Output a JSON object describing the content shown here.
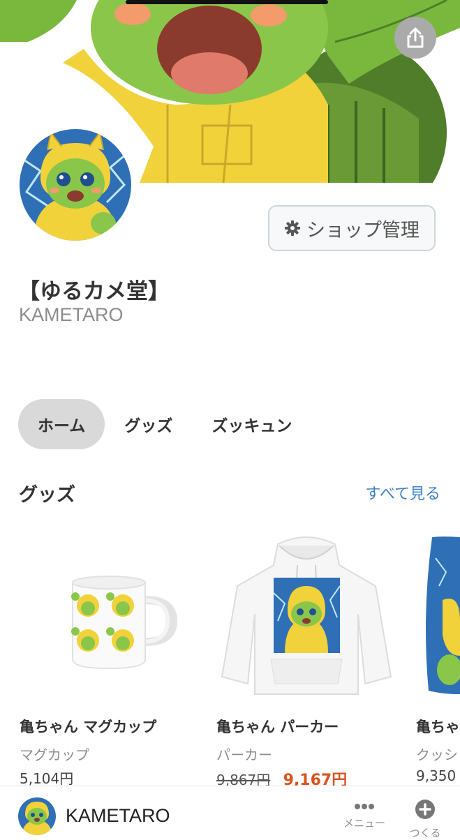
{
  "header": {
    "share_icon": "share-icon"
  },
  "profile": {
    "shop_title": "【ゆるカメ堂】",
    "owner_name": "KAMETARO",
    "manage_button_label": "ショップ管理",
    "manage_icon": "gear-icon"
  },
  "tabs": [
    {
      "label": "ホーム",
      "active": true
    },
    {
      "label": "グッズ",
      "active": false
    },
    {
      "label": "ズッキュン",
      "active": false
    }
  ],
  "goods_section": {
    "title": "グッズ",
    "see_all_label": "すべて見る",
    "items": [
      {
        "name": "亀ちゃん マグカップ",
        "category": "マグカップ",
        "price": "5,104円"
      },
      {
        "name": "亀ちゃん パーカー",
        "category": "パーカー",
        "original_price": "9,867円",
        "sale_price": "9,167円"
      },
      {
        "name": "亀ちゃ",
        "category": "クッシ",
        "price": "9,350"
      }
    ]
  },
  "bottom_bar": {
    "shop_name": "KAMETARO",
    "menu_label": "メニュー",
    "menu_icon": "more-dots-icon",
    "create_label": "つくる",
    "create_icon": "plus-circle-icon"
  },
  "colors": {
    "accent_link": "#3d82c4",
    "sale_price": "#d9531e",
    "active_tab_bg": "#d9d9d9",
    "muted_text": "#8d8d8d"
  }
}
